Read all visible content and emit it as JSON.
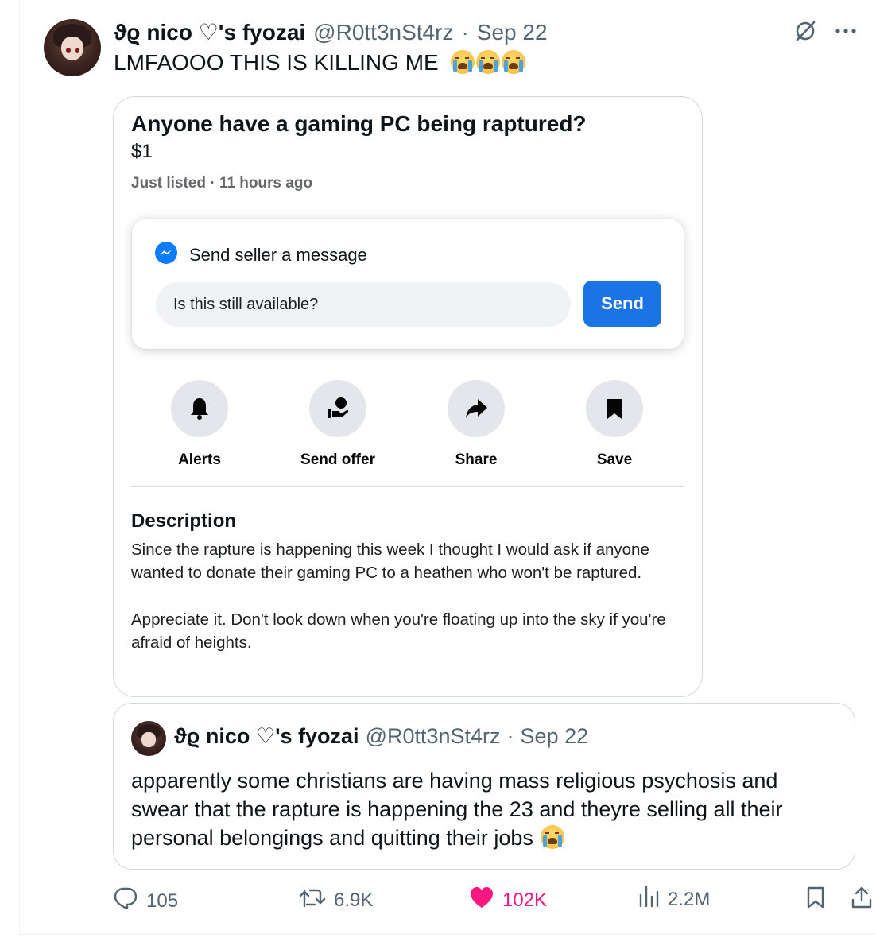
{
  "tweet": {
    "author_name": "ϑϱ nico ♡'s fyozai",
    "handle": "@R0tt3nSt4rz",
    "separator": "·",
    "date": "Sep 22",
    "text": "LMFAOOO THIS IS KILLING ME",
    "emoji": [
      "loudly-crying-face",
      "loudly-crying-face",
      "loudly-crying-face"
    ]
  },
  "listing": {
    "title": "Anyone have a gaming PC being raptured?",
    "price": "$1",
    "meta": "Just listed · 11 hours ago",
    "message_box": {
      "heading": "Send seller a message",
      "input_value": "Is this still available?",
      "send_label": "Send"
    },
    "actions": [
      {
        "label": "Alerts",
        "icon": "bell-icon"
      },
      {
        "label": "Send offer",
        "icon": "offer-icon"
      },
      {
        "label": "Share",
        "icon": "share-arrow-icon"
      },
      {
        "label": "Save",
        "icon": "bookmark-icon"
      }
    ],
    "description_title": "Description",
    "description_p1": "Since the rapture is happening this week I thought I would ask if anyone wanted to donate their gaming PC to a heathen who won't be raptured.",
    "description_p2": "Appreciate it. Don't look down when you're floating up into the sky if you're afraid of heights."
  },
  "quote": {
    "author_name": "ϑϱ nico ♡'s fyozai",
    "handle": "@R0tt3nSt4rz",
    "separator": "·",
    "date": "Sep 22",
    "text": "apparently some christians are having mass religious psychosis and swear that the rapture is happening the 23 and theyre selling all their personal belongings and quitting their jobs",
    "emoji": "loudly-crying-face"
  },
  "metrics": {
    "replies": "105",
    "reposts": "6.9K",
    "likes": "102K",
    "views": "2.2M"
  },
  "colors": {
    "like": "#f91880",
    "send_button": "#1b74e4",
    "messenger": "#0a7cff",
    "muted": "#536471"
  }
}
